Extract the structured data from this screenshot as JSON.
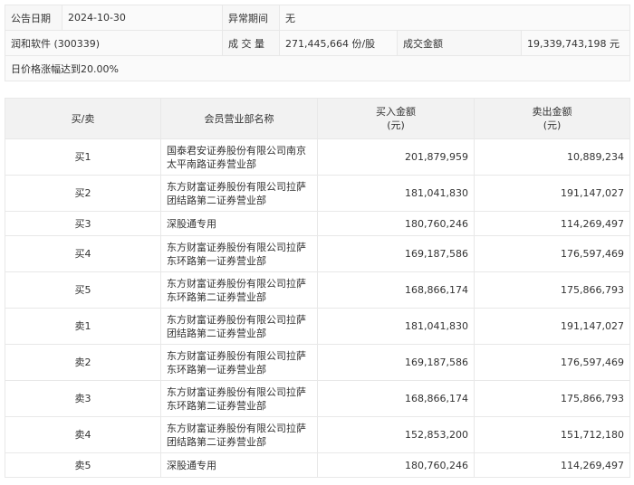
{
  "info": {
    "date_label": "公告日期",
    "date": "2024-10-30",
    "period_label": "异常期间",
    "period": "无",
    "stock": "润和软件 (300339)",
    "volume_label": "成 交 量",
    "volume": "271,445,664 份/股",
    "amount_label": "成交金额",
    "amount": "19,339,743,198 元",
    "reason": "日价格涨幅达到20.00%"
  },
  "table": {
    "headers": [
      "买/卖",
      "会员营业部名称",
      "买入金额\n(元)",
      "卖出金额\n(元)"
    ],
    "rows": [
      {
        "side": "买1",
        "name": "国泰君安证券股份有限公司南京太平南路证券营业部",
        "buy": "201,879,959",
        "sell": "10,889,234"
      },
      {
        "side": "买2",
        "name": "东方财富证券股份有限公司拉萨团结路第二证券营业部",
        "buy": "181,041,830",
        "sell": "191,147,027"
      },
      {
        "side": "买3",
        "name": "深股通专用",
        "buy": "180,760,246",
        "sell": "114,269,497"
      },
      {
        "side": "买4",
        "name": "东方财富证券股份有限公司拉萨东环路第一证券营业部",
        "buy": "169,187,586",
        "sell": "176,597,469"
      },
      {
        "side": "买5",
        "name": "东方财富证券股份有限公司拉萨东环路第二证券营业部",
        "buy": "168,866,174",
        "sell": "175,866,793"
      },
      {
        "side": "卖1",
        "name": "东方财富证券股份有限公司拉萨团结路第二证券营业部",
        "buy": "181,041,830",
        "sell": "191,147,027"
      },
      {
        "side": "卖2",
        "name": "东方财富证券股份有限公司拉萨东环路第一证券营业部",
        "buy": "169,187,586",
        "sell": "176,597,469"
      },
      {
        "side": "卖3",
        "name": "东方财富证券股份有限公司拉萨东环路第二证券营业部",
        "buy": "168,866,174",
        "sell": "175,866,793"
      },
      {
        "side": "卖4",
        "name": "东方财富证券股份有限公司拉萨团结路第二证券营业部",
        "buy": "152,853,200",
        "sell": "151,712,180"
      },
      {
        "side": "卖5",
        "name": "深股通专用",
        "buy": "180,760,246",
        "sell": "114,269,497"
      }
    ]
  }
}
